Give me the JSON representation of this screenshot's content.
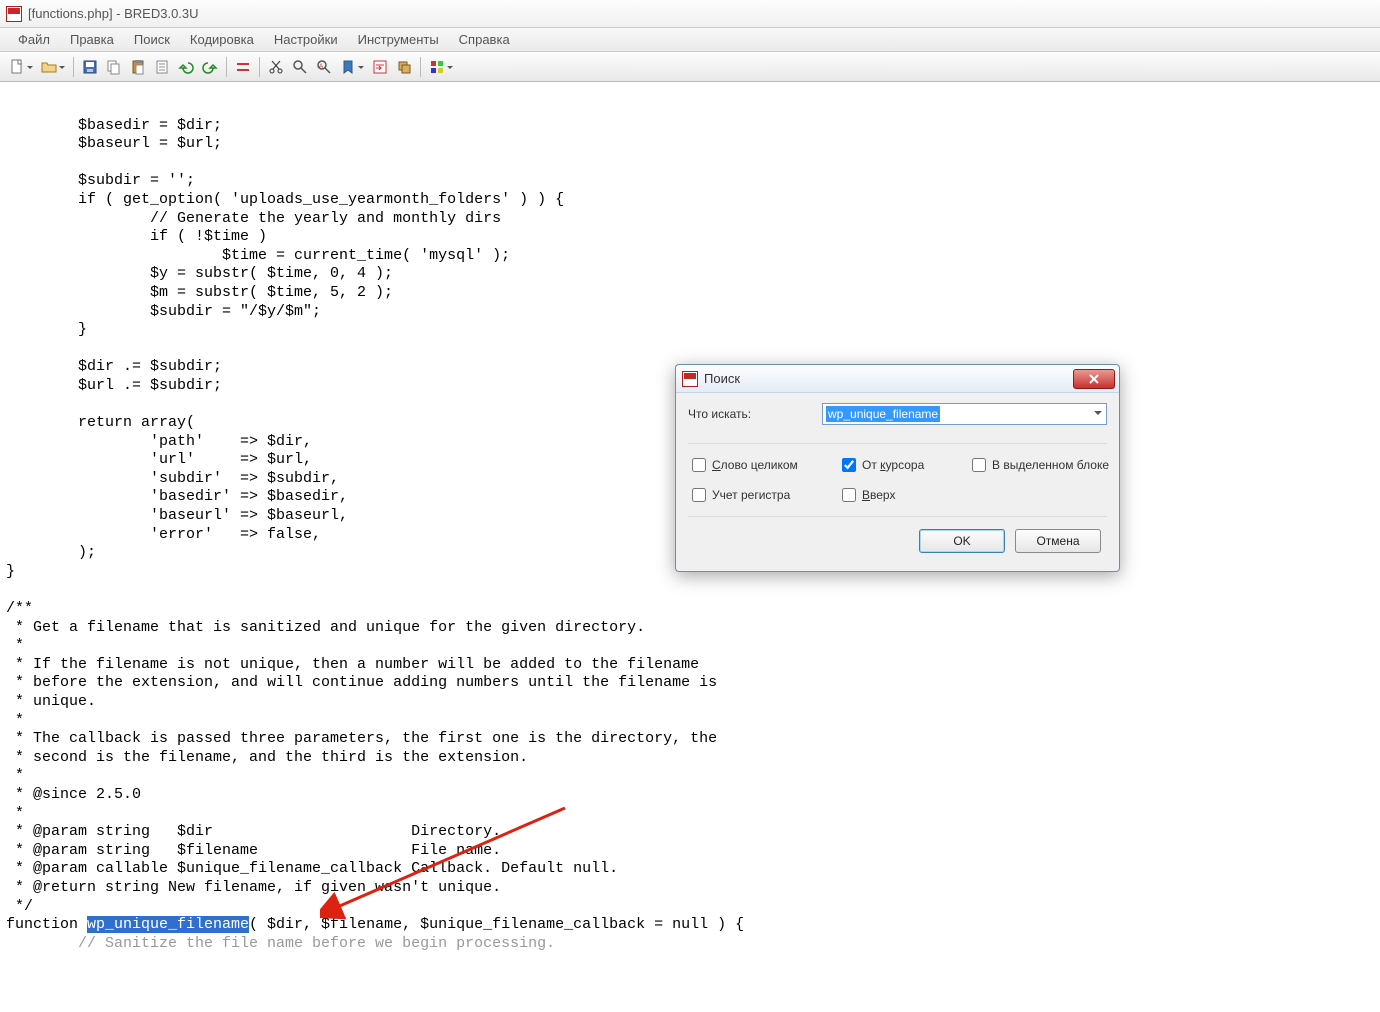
{
  "titlebar": {
    "title": "[functions.php] - BRED3.0.3U"
  },
  "menubar": {
    "file": "Файл",
    "edit": "Правка",
    "search": "Поиск",
    "encoding": "Кодировка",
    "settings": "Настройки",
    "tools": "Инструменты",
    "help": "Справка"
  },
  "toolbar_icons": {
    "new": "new-file-icon",
    "open": "open-folder-icon",
    "save": "save-icon",
    "copy": "copy-icon",
    "paste": "paste-icon",
    "notes": "notes-icon",
    "undo": "undo-icon",
    "redo": "redo-icon",
    "cut": "cut-icon",
    "scissors": "scissors-icon",
    "find": "find-icon",
    "replace": "replace-icon",
    "bookmark": "bookmark-icon",
    "wrap": "wrap-icon",
    "blocks": "copy-stack-icon",
    "palette": "palette-icon"
  },
  "code": {
    "line1": "        $basedir = $dir;",
    "line2": "        $baseurl = $url;",
    "line3": "",
    "line4": "        $subdir = '';",
    "line5": "        if ( get_option( 'uploads_use_yearmonth_folders' ) ) {",
    "line6": "                // Generate the yearly and monthly dirs",
    "line7": "                if ( !$time )",
    "line8": "                        $time = current_time( 'mysql' );",
    "line9": "                $y = substr( $time, 0, 4 );",
    "line10": "                $m = substr( $time, 5, 2 );",
    "line11": "                $subdir = \"/$y/$m\";",
    "line12": "        }",
    "line13": "",
    "line14": "        $dir .= $subdir;",
    "line15": "        $url .= $subdir;",
    "line16": "",
    "line17": "        return array(",
    "line18": "                'path'    => $dir,",
    "line19": "                'url'     => $url,",
    "line20": "                'subdir'  => $subdir,",
    "line21": "                'basedir' => $basedir,",
    "line22": "                'baseurl' => $baseurl,",
    "line23": "                'error'   => false,",
    "line24": "        );",
    "line25": "}",
    "line26": "",
    "line27": "/**",
    "line28": " * Get a filename that is sanitized and unique for the given directory.",
    "line29": " *",
    "line30": " * If the filename is not unique, then a number will be added to the filename",
    "line31": " * before the extension, and will continue adding numbers until the filename is",
    "line32": " * unique.",
    "line33": " *",
    "line34": " * The callback is passed three parameters, the first one is the directory, the",
    "line35": " * second is the filename, and the third is the extension.",
    "line36": " *",
    "line37": " * @since 2.5.0",
    "line38": " *",
    "line39": " * @param string   $dir                      Directory.",
    "line40": " * @param string   $filename                 File name.",
    "line41": " * @param callable $unique_filename_callback Callback. Default null.",
    "line42": " * @return string New filename, if given wasn't unique.",
    "line43": " */",
    "line44a": "function ",
    "line44sel": "wp_unique_filename",
    "line44b": "( $dir, $filename, $unique_filename_callback = null ) {",
    "line45": "        // Sanitize the file name before we begin processing."
  },
  "dialog": {
    "title": "Поиск",
    "label_what": "Что искать:",
    "value": "wp_unique_filename",
    "opt_whole_word": "Слово целиком",
    "opt_from_cursor": "От курсора",
    "opt_in_selection": "В выделенном блоке",
    "opt_match_case": "Учет регистра",
    "opt_up": "Вверх",
    "btn_ok": "OK",
    "btn_cancel": "Отмена",
    "checks": {
      "whole_word": false,
      "from_cursor": true,
      "in_selection": false,
      "match_case": false,
      "up": false
    }
  }
}
